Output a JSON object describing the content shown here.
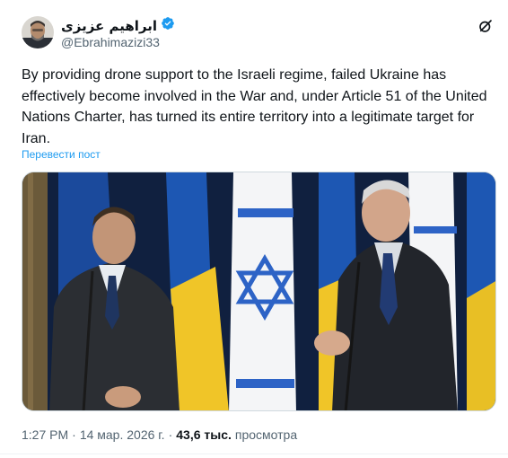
{
  "author": {
    "display_name": "ابراهیم عزیزی",
    "handle": "@Ebrahimazizi33",
    "verified_color": "#1d9bf0"
  },
  "tweet": {
    "text": "By providing drone support to the Israeli regime, failed Ukraine has effectively become involved in the War and, under Article 51 of the United Nations Charter, has turned its entire territory into a legitimate target for Iran.",
    "translate_label": "Перевести пост"
  },
  "meta": {
    "time": "1:27 PM",
    "dot1": "·",
    "date": "14 мар. 2026 г.",
    "dot2": "·",
    "views_count": "43,6 тыс.",
    "views_label": "просмотра"
  },
  "icons": {
    "grok": "grok-icon",
    "verified": "verified-badge-icon"
  },
  "colors": {
    "accent": "#1d9bf0",
    "text": "#0f1419",
    "secondary": "#536471"
  }
}
